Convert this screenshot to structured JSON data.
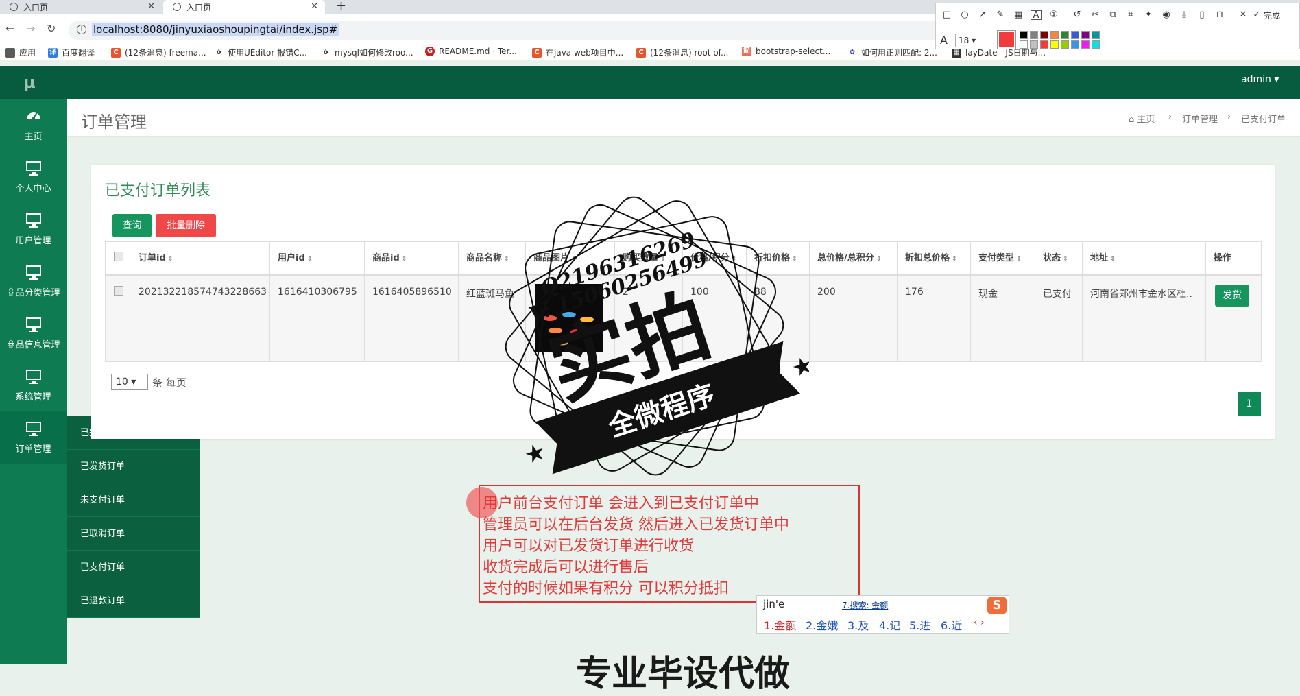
{
  "browser": {
    "tabs": [
      {
        "label": "入口页"
      },
      {
        "label": "入口页"
      }
    ],
    "url": "localhost:8080/jinyuxiaoshoupingtai/index.jsp#",
    "bookmarks": [
      {
        "label": "应用"
      },
      {
        "label": "百度翻译"
      },
      {
        "label": "(12条消息) freema..."
      },
      {
        "label": "使用UEditor 报错C..."
      },
      {
        "label": "mysql如何修改roo..."
      },
      {
        "label": "README.md · Ter..."
      },
      {
        "label": "在java web项目中..."
      },
      {
        "label": "(12条消息) root of..."
      },
      {
        "label": "bootstrap-select..."
      },
      {
        "label": "如何用正则匹配: 2..."
      },
      {
        "label": "layDate - JS日期与..."
      }
    ]
  },
  "screenshot_tool": {
    "done_label": "完成",
    "font_size": "18",
    "current_color": "#f23c3c",
    "swatches": [
      "#000000",
      "#808080",
      "#800000",
      "#f7883a",
      "#308430",
      "#385ad3",
      "#800080",
      "#009999",
      "#ffffff",
      "#c0c0c0",
      "#fb3838",
      "#ffff00",
      "#99cc00",
      "#3894e4",
      "#f31bf3",
      "#16dcdc"
    ]
  },
  "app": {
    "logo": "μ",
    "user_menu": "admin",
    "colors": {
      "header": "#075c3f",
      "sidebar": "#0e7b52",
      "accent": "#17955f",
      "danger": "#f04848"
    },
    "sidebar": [
      {
        "label": "主页",
        "icon": "dashboard-icon"
      },
      {
        "label": "个人中心",
        "icon": "monitor-icon"
      },
      {
        "label": "用户管理",
        "icon": "monitor-icon"
      },
      {
        "label": "商品分类管理",
        "icon": "monitor-icon"
      },
      {
        "label": "商品信息管理",
        "icon": "monitor-icon"
      },
      {
        "label": "系统管理",
        "icon": "monitor-icon"
      },
      {
        "label": "订单管理",
        "icon": "monitor-icon"
      }
    ],
    "submenu": [
      {
        "label": "已完成订单"
      },
      {
        "label": "已发货订单"
      },
      {
        "label": "未支付订单"
      },
      {
        "label": "已取消订单"
      },
      {
        "label": "已支付订单"
      },
      {
        "label": "已退款订单"
      }
    ]
  },
  "page": {
    "title": "订单管理",
    "breadcrumb": [
      "主页",
      "订单管理",
      "已支付订单"
    ],
    "panel_title": "已支付订单列表",
    "buttons": {
      "query": "查询",
      "batch_delete": "批量删除"
    },
    "table": {
      "headers": [
        "订单id",
        "用户id",
        "商品id",
        "商品名称",
        "商品图片",
        "购买数量",
        "价格/积分",
        "折扣价格",
        "总价格/总积分",
        "折扣总价格",
        "支付类型",
        "状态",
        "地址",
        "操作"
      ],
      "rows": [
        {
          "order_id": "20213221857474322866​3",
          "user_id": "1616410306795",
          "product_id": "1616405896510",
          "product_name": "红蓝斑马鱼",
          "quantity": "2",
          "price": "100",
          "discount_price": "88",
          "total": "200",
          "discount_total": "176",
          "pay_type": "现金",
          "status": "已支付",
          "address": "河南省郑州市金水区杜..",
          "action": "发货"
        }
      ]
    },
    "page_size": "10",
    "page_size_label": "条 每页",
    "current_page": "1"
  },
  "watermark": {
    "qq1": "Q2196316269",
    "qq2": "V: 15060256499",
    "main": "实拍",
    "ribbon": "全微程序"
  },
  "annotation": {
    "lines": [
      "用户前台支付订单  会进入到已支付订单中",
      "管理员可以在后台发货  然后进入已发货订单中",
      "用户可以对已发货订单进行收货",
      "收货完成后可以进行售后",
      "支付的时候如果有积分  可以积分抵扣"
    ]
  },
  "ime": {
    "input": "jin'e",
    "search": "7.搜索: 金额",
    "candidates": [
      "1.金额",
      "2.金娥",
      "3.及",
      "4.记",
      "5.进",
      "6.近"
    ]
  },
  "bottom_text": "专业毕设代做"
}
